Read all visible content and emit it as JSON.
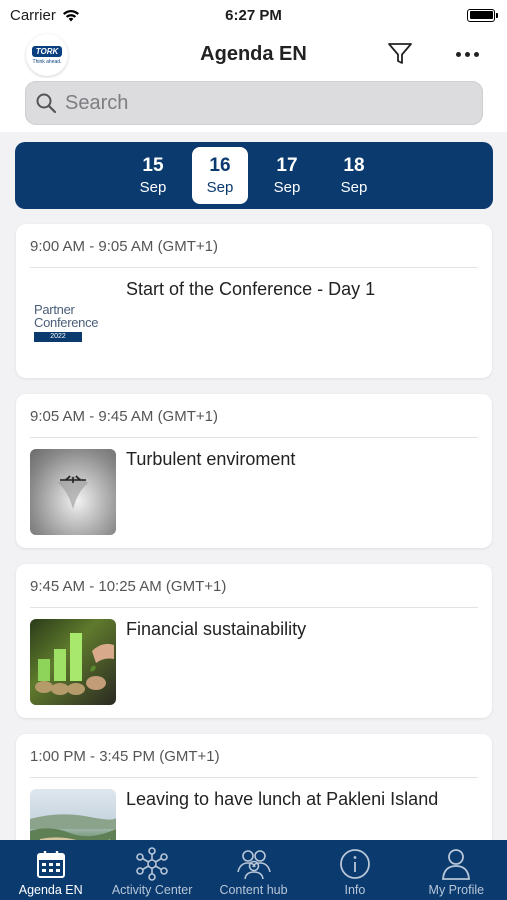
{
  "status": {
    "carrier": "Carrier",
    "time": "6:27 PM",
    "battery_level": 1.0
  },
  "header": {
    "title": "Agenda EN",
    "logo_text": "TORK",
    "logo_tagline": "Think ahead."
  },
  "search": {
    "placeholder": "Search"
  },
  "dates": [
    {
      "day": "15",
      "month": "Sep",
      "active": false
    },
    {
      "day": "16",
      "month": "Sep",
      "active": true
    },
    {
      "day": "17",
      "month": "Sep",
      "active": false
    },
    {
      "day": "18",
      "month": "Sep",
      "active": false
    }
  ],
  "sessions": [
    {
      "time": "9:00 AM - 9:05 AM (GMT+1)",
      "title": "Start of the Conference - Day 1",
      "image": {
        "line1": "Partner",
        "line2": "Conference",
        "year": "2022"
      }
    },
    {
      "time": "9:05 AM - 9:45 AM (GMT+1)",
      "title": "Turbulent enviroment"
    },
    {
      "time": "9:45 AM - 10:25 AM (GMT+1)",
      "title": "Financial sustainability"
    },
    {
      "time": "1:00 PM - 3:45 PM (GMT+1)",
      "title": "Leaving to have lunch at Pakleni Island"
    }
  ],
  "tabs": [
    {
      "label": "Agenda EN",
      "icon": "calendar-icon",
      "active": true
    },
    {
      "label": "Activity Center",
      "icon": "network-icon",
      "active": false
    },
    {
      "label": "Content hub",
      "icon": "people-group-icon",
      "active": false
    },
    {
      "label": "Info",
      "icon": "info-icon",
      "active": false
    },
    {
      "label": "My Profile",
      "icon": "person-icon",
      "active": false
    }
  ],
  "colors": {
    "brand": "#0a3a6e",
    "background": "#f2f2f4"
  }
}
